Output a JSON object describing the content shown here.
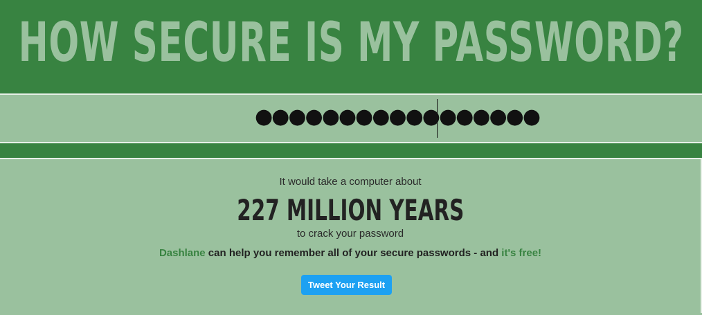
{
  "header": {
    "title": "HOW SECURE IS MY PASSWORD?"
  },
  "password": {
    "masked_value": "●●●●●●●●●●●●●●●●●"
  },
  "result": {
    "lead": "It would take a computer about",
    "time": "227 MILLION YEARS",
    "crack": "to crack your password",
    "promo_brand": "Dashlane",
    "promo_middle": " can help you remember all of your secure passwords - and ",
    "promo_free": "it's free!",
    "tweet_label": "Tweet Your Result"
  },
  "colors": {
    "header_green": "#388341",
    "light_green": "#9ac19e",
    "tweet_blue": "#1da1f2"
  }
}
